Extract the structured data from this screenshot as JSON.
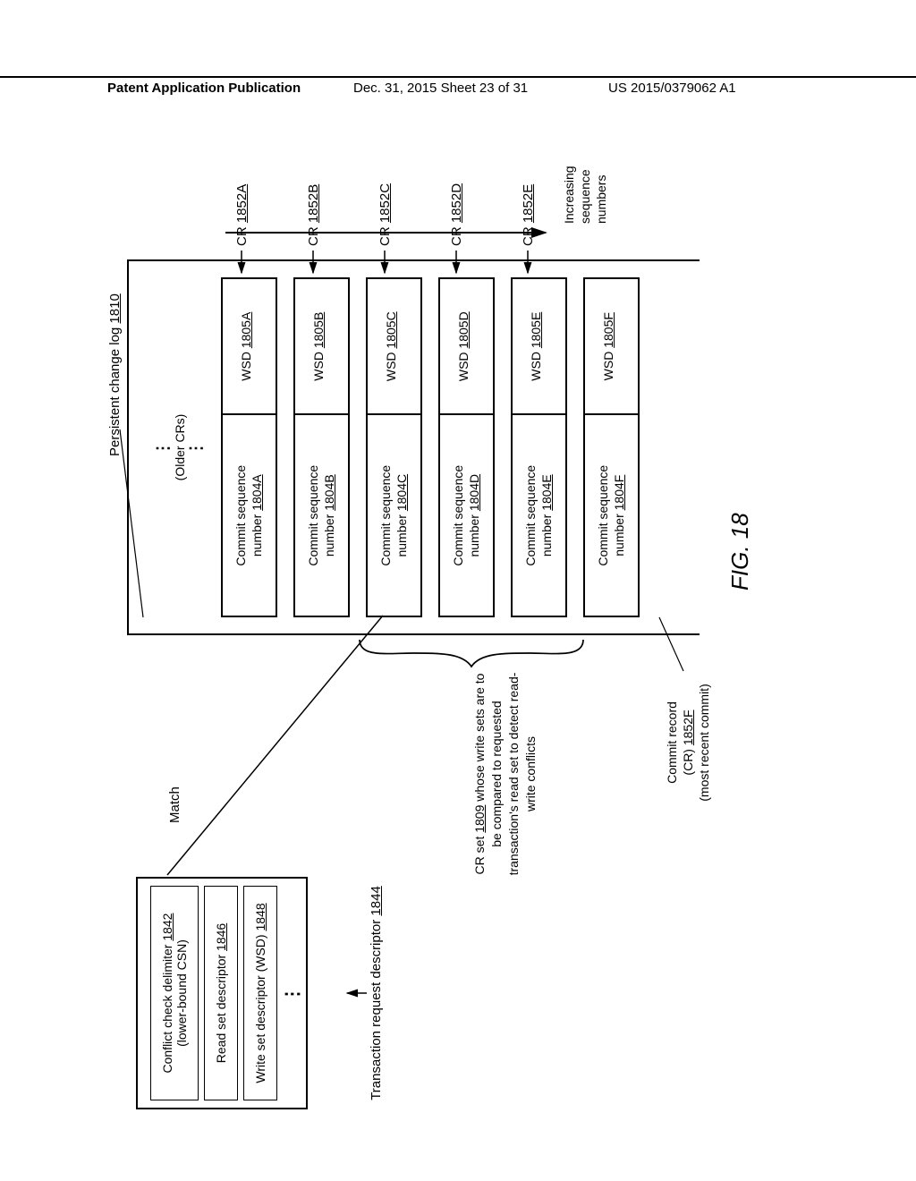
{
  "header": {
    "left": "Patent Application Publication",
    "mid": "Dec. 31, 2015  Sheet 23 of 31",
    "right": "US 2015/0379062 A1"
  },
  "trd": {
    "row1": "Conflict check delimiter 1842 (lower-bound CSN)",
    "row1_num": "1842",
    "row2": "Read set descriptor 1846",
    "row2_num": "1846",
    "row3": "Write set descriptor (WSD) 1848",
    "row3_num": "1848",
    "label": "Transaction request descriptor 1844",
    "label_num": "1844"
  },
  "match": "Match",
  "cr_set": {
    "text": "CR set 1809 whose write sets are to be compared to requested transaction's read set to detect read-write conflicts",
    "num": "1809"
  },
  "commit_record_label": {
    "l1": "Commit record",
    "l2": "(CR) 1852F",
    "l2_num": "1852F",
    "l3": "(most recent commit)"
  },
  "log": {
    "title": "Persistent change log 1810",
    "title_num": "1810",
    "older": "(Older CRs)",
    "rows": [
      {
        "seq_num": "1804A",
        "wsd_num": "1805A",
        "cr_label": "CR 1852A",
        "cr_num": "1852A"
      },
      {
        "seq_num": "1804B",
        "wsd_num": "1805B",
        "cr_label": "CR 1852B",
        "cr_num": "1852B"
      },
      {
        "seq_num": "1804C",
        "wsd_num": "1805C",
        "cr_label": "CR 1852C",
        "cr_num": "1852C"
      },
      {
        "seq_num": "1804D",
        "wsd_num": "1805D",
        "cr_label": "CR 1852D",
        "cr_num": "1852D"
      },
      {
        "seq_num": "1804E",
        "wsd_num": "1805E",
        "cr_label": "CR 1852E",
        "cr_num": "1852E"
      },
      {
        "seq_num": "1804F",
        "wsd_num": "1805F",
        "cr_label": "",
        "cr_num": ""
      }
    ],
    "seq_prefix": "Commit sequence number ",
    "wsd_prefix": "WSD "
  },
  "seq_arrow": "Increasing sequence numbers",
  "figure": "FIG. 18"
}
